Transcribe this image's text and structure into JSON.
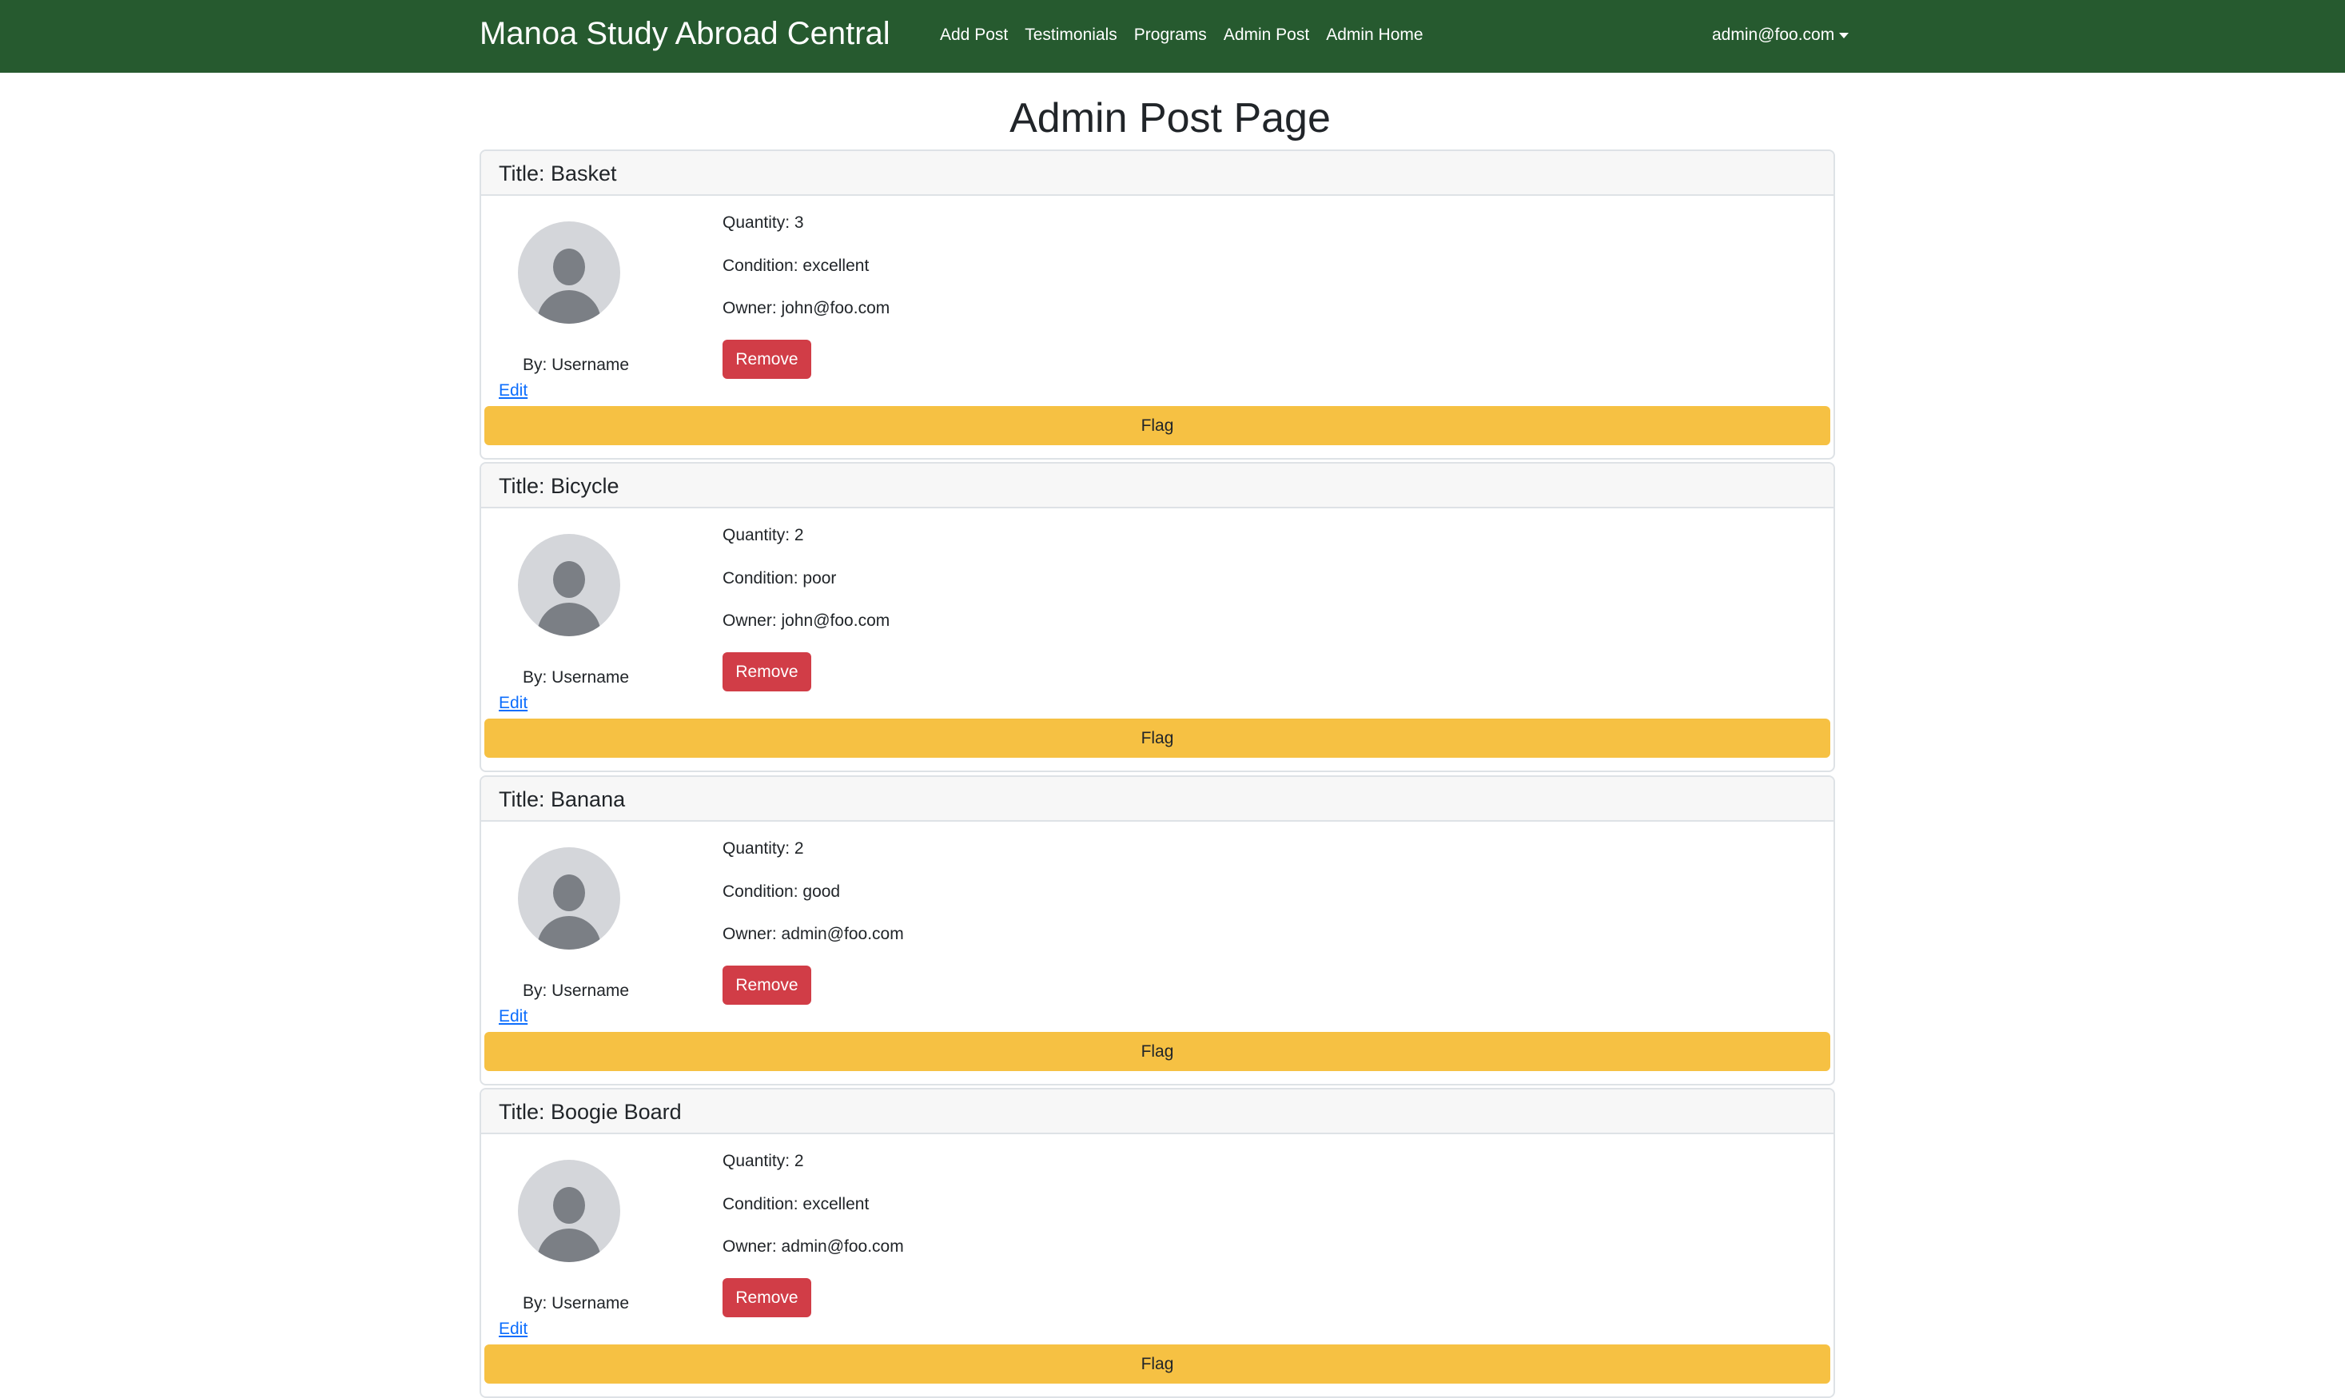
{
  "navbar": {
    "brand": "Manoa Study Abroad Central",
    "links": [
      "Add Post",
      "Testimonials",
      "Programs",
      "Admin Post",
      "Admin Home"
    ],
    "user": "admin@foo.com",
    "background_color": "#265a2f"
  },
  "page": {
    "title": "Admin Post Page"
  },
  "posts": [
    {
      "title": "Title: Basket",
      "quantity": "Quantity: 3",
      "condition": "Condition: excellent",
      "owner": "Owner: john@foo.com",
      "by": "By: Username",
      "edit_label": "Edit",
      "remove_label": "Remove",
      "flag_label": "Flag"
    },
    {
      "title": "Title: Bicycle",
      "quantity": "Quantity: 2",
      "condition": "Condition: poor",
      "owner": "Owner: john@foo.com",
      "by": "By: Username",
      "edit_label": "Edit",
      "remove_label": "Remove",
      "flag_label": "Flag"
    },
    {
      "title": "Title: Banana",
      "quantity": "Quantity: 2",
      "condition": "Condition: good",
      "owner": "Owner: admin@foo.com",
      "by": "By: Username",
      "edit_label": "Edit",
      "remove_label": "Remove",
      "flag_label": "Flag"
    },
    {
      "title": "Title: Boogie Board",
      "quantity": "Quantity: 2",
      "condition": "Condition: excellent",
      "owner": "Owner: admin@foo.com",
      "by": "By: Username",
      "edit_label": "Edit",
      "remove_label": "Remove",
      "flag_label": "Flag"
    }
  ],
  "icons": {
    "avatar": "user-avatar-icon",
    "user_menu_caret": "caret-down-icon"
  },
  "colors": {
    "remove_button": "#d13d47",
    "flag_button": "#f6c143",
    "edit_link": "#0d6efd"
  }
}
